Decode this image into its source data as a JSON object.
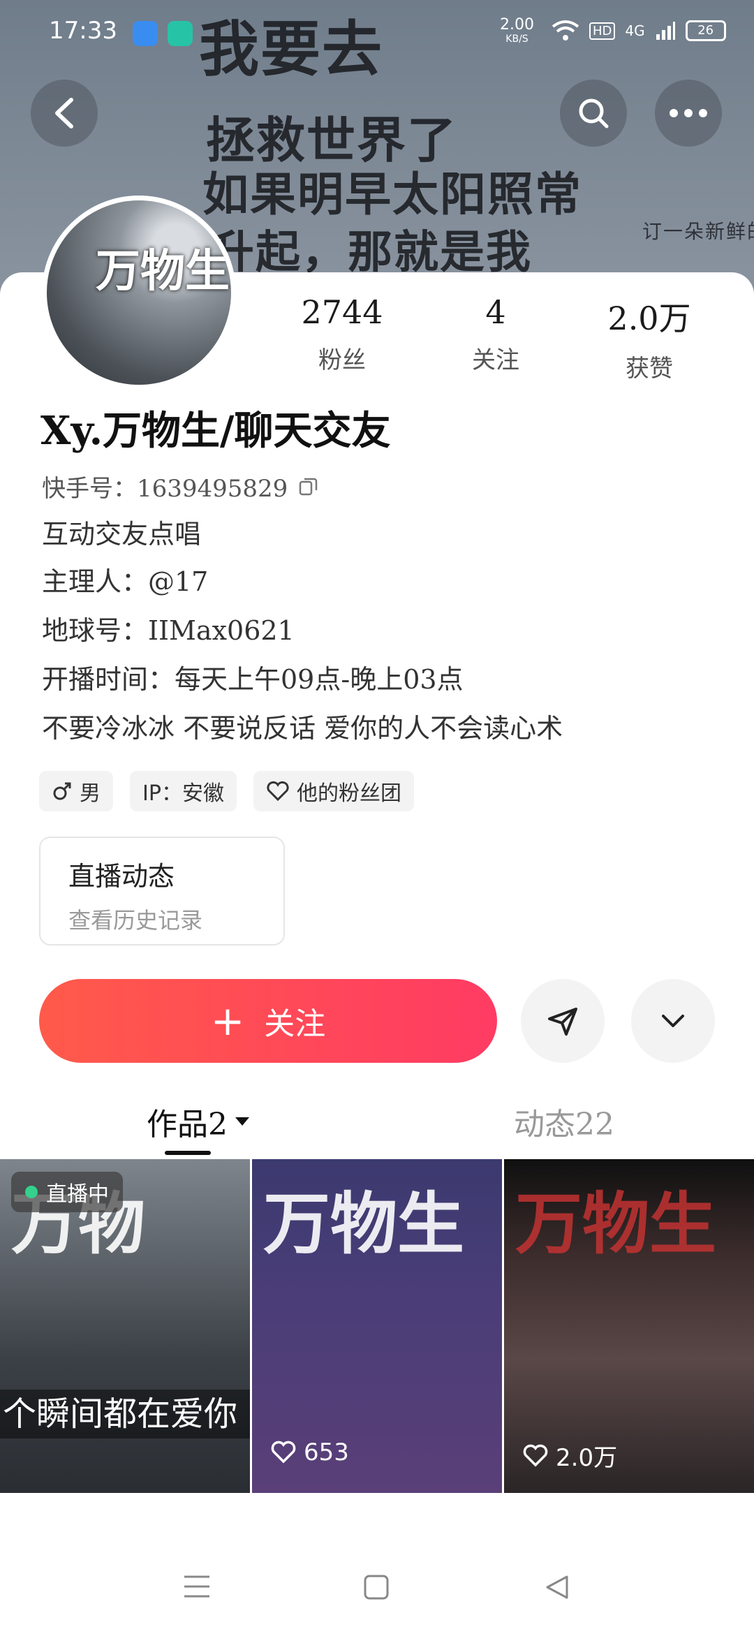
{
  "status_bar": {
    "time": "17:33",
    "net_speed_value": "2.00",
    "net_speed_unit": "KB/S",
    "hd_badge": "HD",
    "network": "4G",
    "battery": "26"
  },
  "cover": {
    "lines": [
      "我要去",
      "拯救世界了",
      "如果明早太阳照常",
      "升起，那就是我",
      "订一朵新鲜的云"
    ]
  },
  "avatar_text": "万物生",
  "stats": [
    {
      "value": "2744",
      "label": "粉丝"
    },
    {
      "value": "4",
      "label": "关注"
    },
    {
      "value": "2.0万",
      "label": "获赞"
    }
  ],
  "profile": {
    "name": "Xy.万物生/聊天交友",
    "id": "快手号：1639495829",
    "bio": [
      "互动交友点唱",
      "主理人：@17",
      "地球号：IIMax0621",
      "开播时间：每天上午09点-晚上03点",
      "不要冷冰冰 不要说反话 爱你的人不会读心术"
    ]
  },
  "tags": {
    "gender": "男",
    "ip": "IP：安徽",
    "fan_group": "他的粉丝团"
  },
  "live_card": {
    "title": "直播动态",
    "subtitle": "查看历史记录"
  },
  "actions": {
    "follow_label": "关注"
  },
  "tabs": {
    "works": "作品2",
    "moments": "动态22"
  },
  "grid": [
    {
      "badge": "直播中",
      "title": "万物",
      "caption": "个瞬间都在爱你"
    },
    {
      "title": "万物生",
      "likes": "653"
    },
    {
      "title": "万物生",
      "likes": "2.0万"
    }
  ],
  "colors": {
    "accent_start": "#ff5a4a",
    "accent_end": "#ff3b63",
    "live_dot": "#33d18b"
  },
  "icons": [
    "back-icon",
    "search-icon",
    "more-icon",
    "copy-icon",
    "male-icon",
    "heart-icon",
    "plus-icon",
    "send-icon",
    "chevron-down-icon",
    "menu-icon",
    "home-icon",
    "nav-back-icon"
  ]
}
